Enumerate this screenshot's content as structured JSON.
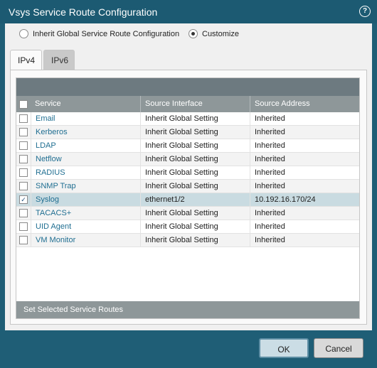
{
  "dialog": {
    "title": "Vsys Service Route Configuration",
    "help_icon": "help-icon",
    "help_glyph": "?"
  },
  "radios": [
    {
      "label": "Inherit Global Service Route Configuration",
      "selected": false
    },
    {
      "label": "Customize",
      "selected": true
    }
  ],
  "tabs": [
    {
      "label": "IPv4",
      "active": true
    },
    {
      "label": "IPv6",
      "active": false
    }
  ],
  "table": {
    "columns": [
      "Service",
      "Source Interface",
      "Source Address"
    ],
    "rows": [
      {
        "service": "Email",
        "interface": "Inherit Global Setting",
        "address": "Inherited",
        "checked": false
      },
      {
        "service": "Kerberos",
        "interface": "Inherit Global Setting",
        "address": "Inherited",
        "checked": false
      },
      {
        "service": "LDAP",
        "interface": "Inherit Global Setting",
        "address": "Inherited",
        "checked": false
      },
      {
        "service": "Netflow",
        "interface": "Inherit Global Setting",
        "address": "Inherited",
        "checked": false
      },
      {
        "service": "RADIUS",
        "interface": "Inherit Global Setting",
        "address": "Inherited",
        "checked": false
      },
      {
        "service": "SNMP Trap",
        "interface": "Inherit Global Setting",
        "address": "Inherited",
        "checked": false
      },
      {
        "service": "Syslog",
        "interface": "ethernet1/2",
        "address": "10.192.16.170/24",
        "checked": true
      },
      {
        "service": "TACACS+",
        "interface": "Inherit Global Setting",
        "address": "Inherited",
        "checked": false
      },
      {
        "service": "UID Agent",
        "interface": "Inherit Global Setting",
        "address": "Inherited",
        "checked": false
      },
      {
        "service": "VM Monitor",
        "interface": "Inherit Global Setting",
        "address": "Inherited",
        "checked": false
      }
    ],
    "footer": "Set Selected Service Routes"
  },
  "buttons": {
    "ok": "OK",
    "cancel": "Cancel"
  },
  "colors": {
    "titlebar": "#1c5a72",
    "accent_link": "#1f6e91",
    "selected_row": "#c9dbe1"
  }
}
